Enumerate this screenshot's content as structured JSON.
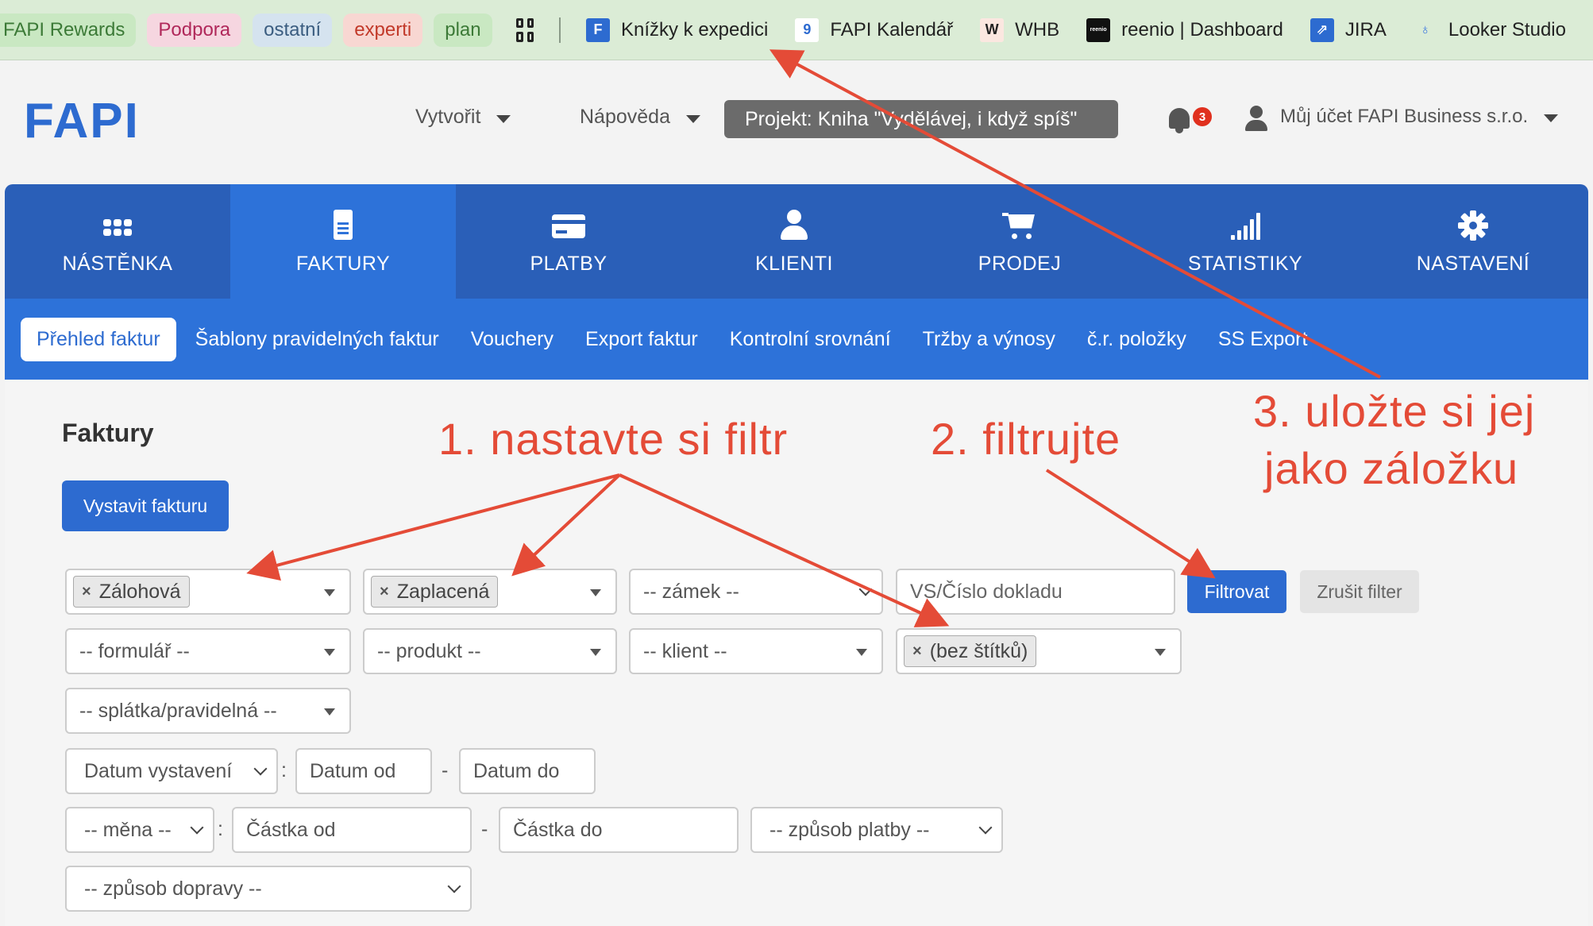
{
  "bookmarks": {
    "pills": [
      {
        "label": "FAPI Rewards",
        "bg": "#c9e8c2",
        "color": "#3c7a37"
      },
      {
        "label": "Podpora",
        "bg": "#f6d6e0",
        "color": "#b0285a"
      },
      {
        "label": "ostatní",
        "bg": "#d5e3ef",
        "color": "#3b5d80"
      },
      {
        "label": "experti",
        "bg": "#f8d7d2",
        "color": "#c23a2a"
      },
      {
        "label": "plan",
        "bg": "#c9e8c2",
        "color": "#3c7a37"
      }
    ],
    "links": [
      {
        "label": "Knížky k expedici",
        "icon": "fapi-f-icon",
        "icon_text": "F",
        "icon_bg": "#2d6bd0",
        "icon_color": "#fff"
      },
      {
        "label": "FAPI Kalendář",
        "icon": "calendar-icon",
        "icon_text": "9",
        "icon_bg": "#fff",
        "icon_color": "#2d6bd0"
      },
      {
        "label": "WHB",
        "icon": "whb-w-icon",
        "icon_text": "W",
        "icon_bg": "#fbe7e0",
        "icon_color": "#222"
      },
      {
        "label": "reenio | Dashboard",
        "icon": "reenio-icon",
        "icon_text": "reenio",
        "icon_bg": "#111",
        "icon_color": "#fff"
      },
      {
        "label": "JIRA",
        "icon": "jira-icon",
        "icon_text": "⇗",
        "icon_bg": "#2d6bd0",
        "icon_color": "#fff"
      },
      {
        "label": "Looker Studio",
        "icon": "looker-icon",
        "icon_text": "♁",
        "icon_bg": "transparent",
        "icon_color": "#3b76e0"
      }
    ]
  },
  "header": {
    "logo": "FAPI",
    "menu_create": "Vytvořit",
    "menu_help": "Nápověda",
    "project": "Projekt: Kniha \"Vydělávej, i když spíš\"",
    "notifications_count": "3",
    "account": "Můj účet FAPI Business s.r.o."
  },
  "mainnav": [
    {
      "label": "NÁSTĚNKA",
      "icon": "dashboard-grid-icon",
      "active": false
    },
    {
      "label": "FAKTURY",
      "icon": "invoice-document-icon",
      "active": true
    },
    {
      "label": "PLATBY",
      "icon": "credit-card-icon",
      "active": false
    },
    {
      "label": "KLIENTI",
      "icon": "user-icon",
      "active": false
    },
    {
      "label": "PRODEJ",
      "icon": "shopping-cart-icon",
      "active": false
    },
    {
      "label": "STATISTIKY",
      "icon": "signal-bars-icon",
      "active": false
    },
    {
      "label": "NASTAVENÍ",
      "icon": "gear-icon",
      "active": false
    }
  ],
  "subnav": [
    {
      "label": "Přehled faktur",
      "active": true
    },
    {
      "label": "Šablony pravidelných faktur",
      "active": false
    },
    {
      "label": "Vouchery",
      "active": false
    },
    {
      "label": "Export faktur",
      "active": false
    },
    {
      "label": "Kontrolní srovnání",
      "active": false
    },
    {
      "label": "Tržby a výnosy",
      "active": false
    },
    {
      "label": "č.r. položky",
      "active": false
    },
    {
      "label": "SS Export",
      "active": false
    }
  ],
  "content": {
    "title": "Faktury",
    "create_invoice": "Vystavit fakturu",
    "filters": {
      "type_tag": "Zálohová",
      "status_tag": "Zaplacená",
      "lock": "-- zámek --",
      "doc_number_placeholder": "VS/Číslo dokladu",
      "form": "-- formulář --",
      "product": "-- produkt --",
      "client": "-- klient --",
      "tags_tag": "(bez štítků)",
      "installment": "-- splátka/pravidelná --",
      "date_type": "Datum vystavení",
      "date_from": "Datum od",
      "date_to": "Datum do",
      "currency": "-- měna --",
      "amount_from": "Částka od",
      "amount_to": "Částka do",
      "payment_method": "-- způsob platby --",
      "shipping_method": "-- způsob dopravy --"
    },
    "filter_button": "Filtrovat",
    "clear_button": "Zrušit filter"
  },
  "annotations": {
    "step1": "1. nastavte si filtr",
    "step2": "2. filtrujte",
    "step3_line1": "3. uložte si jej",
    "step3_line2": "jako záložku",
    "color": "#e44b37"
  }
}
